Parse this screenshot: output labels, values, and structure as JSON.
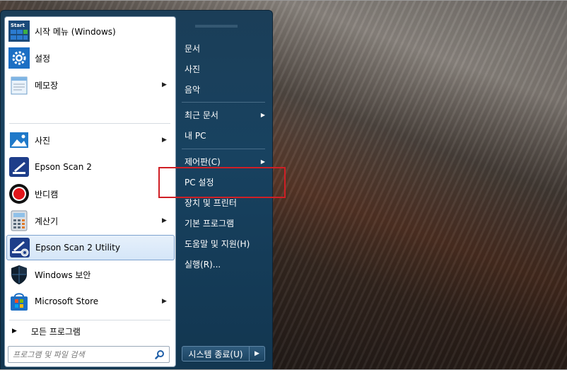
{
  "left_panel": {
    "pinned": [
      {
        "label": "시작 메뉴 (Windows)",
        "icon": "start-menu-icon",
        "has_submenu": false
      },
      {
        "label": "설정",
        "icon": "settings-gear-icon",
        "has_submenu": false
      },
      {
        "label": "메모장",
        "icon": "notepad-icon",
        "has_submenu": true
      }
    ],
    "recent": [
      {
        "label": "사진",
        "icon": "photos-icon",
        "has_submenu": true
      },
      {
        "label": "Epson Scan 2",
        "icon": "epson-scan-icon",
        "has_submenu": false
      },
      {
        "label": "반디캠",
        "icon": "bandicam-record-icon",
        "has_submenu": false
      },
      {
        "label": "계산기",
        "icon": "calculator-icon",
        "has_submenu": true
      },
      {
        "label": "Epson Scan 2 Utility",
        "icon": "epson-scan-utility-icon",
        "has_submenu": false,
        "selected": true
      },
      {
        "label": "Windows 보안",
        "icon": "windows-security-shield-icon",
        "has_submenu": false
      },
      {
        "label": "Microsoft Store",
        "icon": "microsoft-store-icon",
        "has_submenu": true
      }
    ],
    "all_programs_label": "모든 프로그램",
    "search_placeholder": "프로그램 및 파일 검색",
    "start_icon_text": "Start"
  },
  "right_panel": {
    "links": [
      {
        "label": "문서",
        "has_submenu": false
      },
      {
        "label": "사진",
        "has_submenu": false
      },
      {
        "label": "음악",
        "has_submenu": false
      },
      {
        "label": "최근 문서",
        "has_submenu": true
      },
      {
        "label": "내 PC",
        "has_submenu": false
      },
      {
        "label": "제어판(C)",
        "has_submenu": true
      },
      {
        "label": "PC 설정",
        "has_submenu": false,
        "highlighted": true
      },
      {
        "label": "장치 및 프린터",
        "has_submenu": false
      },
      {
        "label": "기본 프로그램",
        "has_submenu": false
      },
      {
        "label": "도움말 및 지원(H)",
        "has_submenu": false
      },
      {
        "label": "실행(R)...",
        "has_submenu": false
      }
    ],
    "shutdown_label": "시스템 종료(U)"
  },
  "colors": {
    "highlight_box": "#d01f25",
    "menu_bg": "#184260",
    "selected_item_bg": "#d5e6f8"
  }
}
